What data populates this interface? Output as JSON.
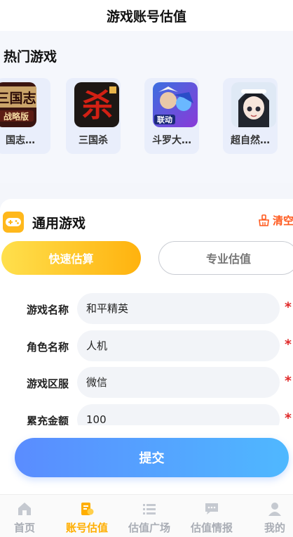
{
  "header": {
    "title": "游戏账号估值"
  },
  "hot_games": {
    "title": "热门游戏",
    "items": [
      {
        "name": "国志…",
        "icon": "sanguozhi-game-icon"
      },
      {
        "name": "三国杀",
        "icon": "sanguosha-game-icon"
      },
      {
        "name": "斗罗大…",
        "icon": "douluo-game-icon"
      },
      {
        "name": "超自然…",
        "icon": "chaoziran-game-icon"
      }
    ],
    "badges": {
      "sanguozhi_top": "三国志",
      "sanguozhi_bottom": "战略版",
      "sanguosha_logo": "杀",
      "douluo_tag": "联动"
    }
  },
  "general": {
    "title": "通用游戏",
    "clear_label": "清空",
    "tabs": {
      "quick": "快速估算",
      "pro": "专业估值"
    }
  },
  "form": {
    "rows": [
      {
        "label": "游戏名称",
        "value": "和平精英"
      },
      {
        "label": "角色名称",
        "value": "人机"
      },
      {
        "label": "游戏区服",
        "value": "微信"
      },
      {
        "label": "累充金额",
        "value": "100"
      }
    ],
    "required_mark": "*"
  },
  "submit_label": "提交",
  "tabbar": {
    "items": [
      {
        "label": "首页",
        "icon": "home-icon"
      },
      {
        "label": "账号估值",
        "icon": "valuation-icon",
        "active": true
      },
      {
        "label": "估值广场",
        "icon": "list-icon"
      },
      {
        "label": "估值情报",
        "icon": "chat-icon"
      },
      {
        "label": "我的",
        "icon": "user-icon"
      }
    ]
  },
  "colors": {
    "accent": "#ffae00",
    "submit_start": "#5a8cff",
    "submit_end": "#4fb8ff",
    "required": "#e02a2a",
    "clear": "#ff5a1f"
  }
}
